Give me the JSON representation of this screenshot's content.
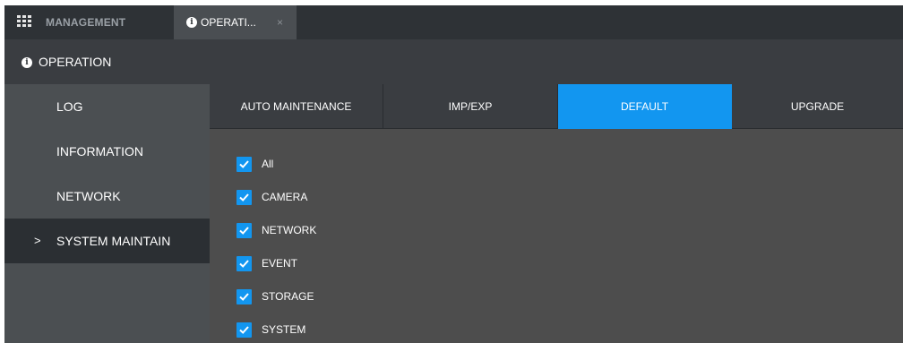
{
  "topbar": {
    "grid_icon": "grid-icon",
    "tabs": [
      {
        "label": "MANAGEMENT"
      },
      {
        "label": "OPERATI...",
        "icon": "info-icon",
        "close": "×"
      }
    ]
  },
  "header": {
    "icon": "info-icon",
    "title": "OPERATION"
  },
  "sidebar": {
    "items": [
      {
        "label": "LOG"
      },
      {
        "label": "INFORMATION"
      },
      {
        "label": "NETWORK"
      },
      {
        "label": "SYSTEM MAINTAIN",
        "chevron": ">"
      }
    ]
  },
  "content": {
    "tabs": [
      {
        "label": "AUTO MAINTENANCE"
      },
      {
        "label": "IMP/EXP"
      },
      {
        "label": "DEFAULT"
      },
      {
        "label": "UPGRADE"
      }
    ],
    "checklist": [
      {
        "label": "All",
        "checked": true
      },
      {
        "label": "CAMERA",
        "checked": true
      },
      {
        "label": "NETWORK",
        "checked": true
      },
      {
        "label": "EVENT",
        "checked": true
      },
      {
        "label": "STORAGE",
        "checked": true
      },
      {
        "label": "SYSTEM",
        "checked": true
      }
    ]
  },
  "colors": {
    "accent": "#1296f0",
    "topbar": "#2e3236",
    "panel": "#3a3d41",
    "sidebar": "#4b4f52",
    "sidebar_active": "#2b2f33",
    "content_bg": "#4d4d4d"
  }
}
